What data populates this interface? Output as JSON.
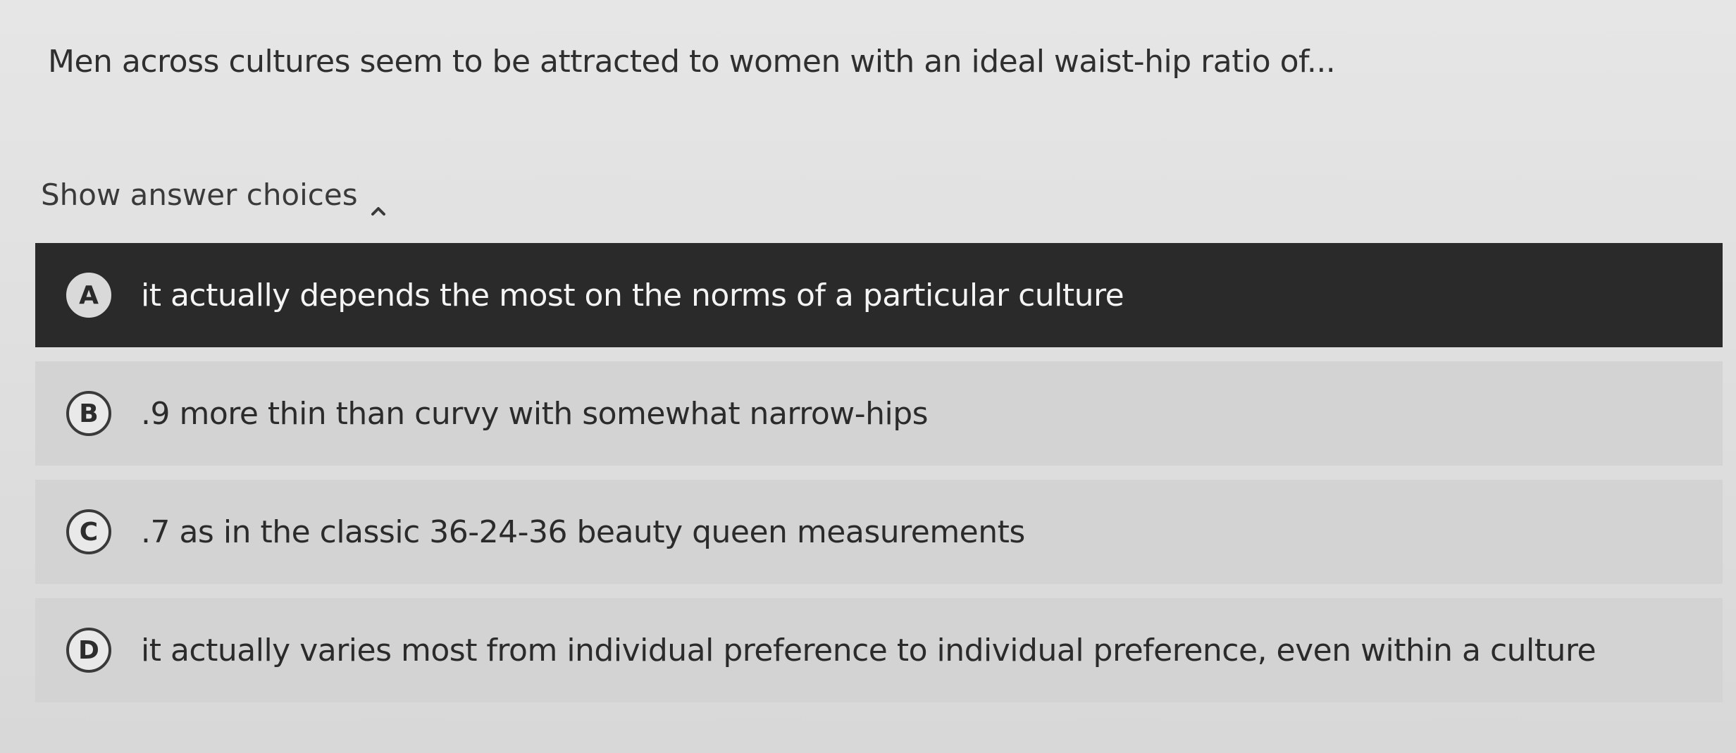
{
  "question": {
    "text": "Men across cultures seem to be attracted to women with an ideal waist-hip ratio of..."
  },
  "toggle": {
    "label": "Show answer choices",
    "icon": "chevron-up-icon"
  },
  "choices": [
    {
      "letter": "A",
      "text": "it actually depends the most on the norms of a particular culture",
      "selected": true
    },
    {
      "letter": "B",
      "text": ".9 more thin than curvy with somewhat narrow-hips",
      "selected": false
    },
    {
      "letter": "C",
      "text": ".7 as in the classic 36-24-36 beauty queen measurements",
      "selected": false
    },
    {
      "letter": "D",
      "text": "it actually varies most from individual preference to individual preference, even within a culture",
      "selected": false
    }
  ],
  "colors": {
    "selected_bg": "#2a2a2a",
    "choice_bg": "#d3d3d3",
    "page_bg": "#e2e2e2"
  }
}
